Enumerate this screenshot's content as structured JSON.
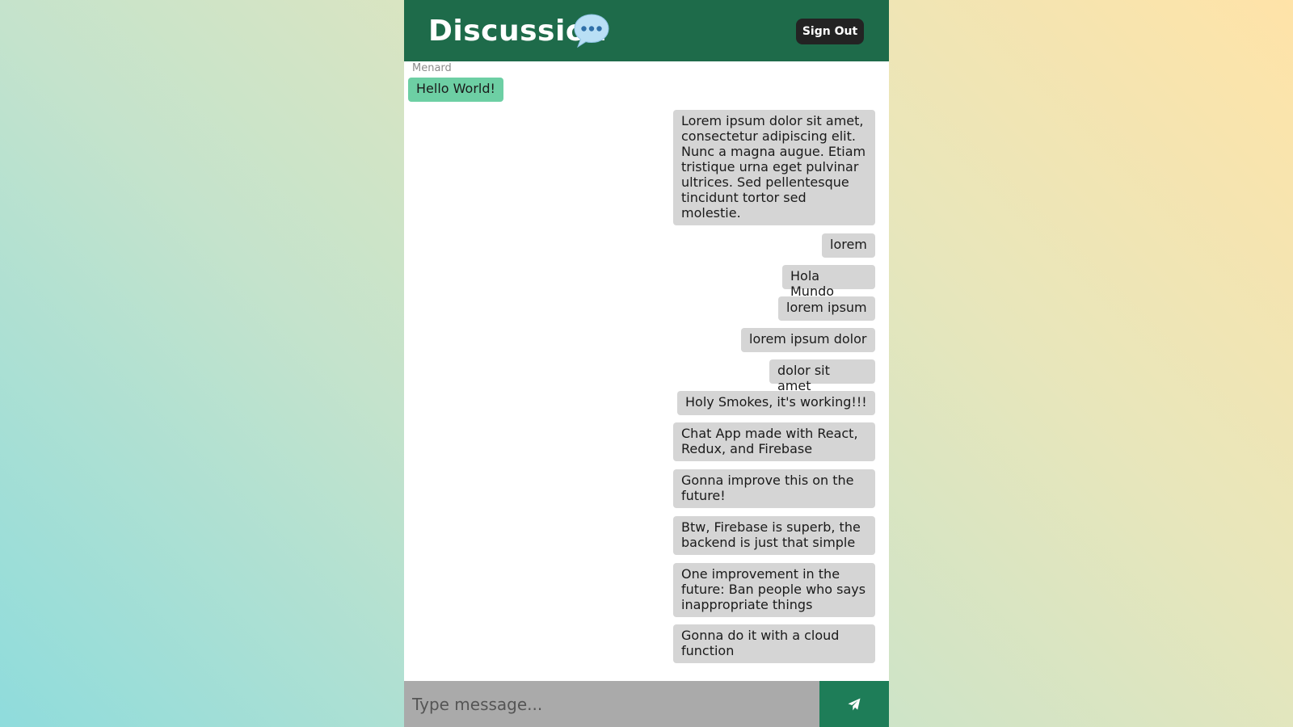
{
  "app": {
    "title": "Discussion",
    "icon": "speech-bubble-icon"
  },
  "header": {
    "sign_out_label": "Sign Out"
  },
  "messages": [
    {
      "sender": "Menard",
      "text": "Hello World!",
      "direction": "incoming"
    },
    {
      "text": "Lorem ipsum dolor sit amet, consectetur adipiscing elit. Nunc a magna augue. Etiam tristique urna eget pulvinar ultrices. Sed pellentesque tincidunt tortor sed molestie.",
      "direction": "outgoing"
    },
    {
      "text": "lorem",
      "direction": "outgoing"
    },
    {
      "text": "Hola Mundo",
      "direction": "outgoing"
    },
    {
      "text": "lorem ipsum",
      "direction": "outgoing"
    },
    {
      "text": "lorem ipsum dolor",
      "direction": "outgoing"
    },
    {
      "text": "dolor sit amet",
      "direction": "outgoing"
    },
    {
      "text": "Holy Smokes, it's working!!!",
      "direction": "outgoing"
    },
    {
      "text": "Chat App made with React, Redux, and Firebase",
      "direction": "outgoing"
    },
    {
      "text": "Gonna improve this on the future!",
      "direction": "outgoing"
    },
    {
      "text": "Btw, Firebase is superb, the backend is just that simple",
      "direction": "outgoing"
    },
    {
      "text": "One improvement in the future: Ban people who says inappropriate things",
      "direction": "outgoing"
    },
    {
      "text": "Gonna do it with a cloud function",
      "direction": "outgoing"
    }
  ],
  "composer": {
    "placeholder": "Type message...",
    "value": "",
    "send_icon": "send-icon"
  },
  "colors": {
    "header": "#1e6b4a",
    "sign_out_button": "#232323",
    "incoming_bubble": "#6dcfa4",
    "outgoing_bubble": "#d5d5d5",
    "input_background": "#aaaaaa",
    "send_button": "#1e7d58"
  }
}
